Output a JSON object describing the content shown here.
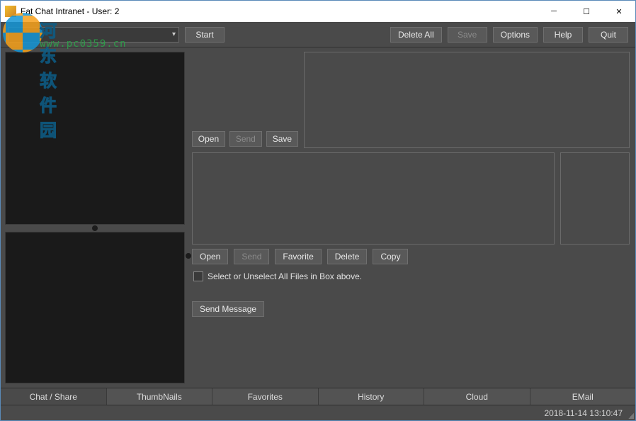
{
  "title": "Fat Chat Intranet - User: 2",
  "watermark": {
    "text1": "河东软件园",
    "text2": "www.pc0359.cn"
  },
  "toolbar": {
    "start": "Start",
    "deleteAll": "Delete All",
    "save": "Save",
    "options": "Options",
    "help": "Help",
    "quit": "Quit"
  },
  "section1": {
    "open": "Open",
    "send": "Send",
    "save": "Save"
  },
  "section2": {
    "open": "Open",
    "send": "Send",
    "favorite": "Favorite",
    "delete": "Delete",
    "copy": "Copy"
  },
  "checkboxLabel": "Select or Unselect All Files in Box above.",
  "sendMessage": "Send Message",
  "tabs": [
    "Chat / Share",
    "ThumbNails",
    "Favorites",
    "History",
    "Cloud",
    "EMail"
  ],
  "status": {
    "timestamp": "2018-11-14 13:10:47"
  },
  "winControls": {
    "min": "─",
    "max": "☐",
    "close": "✕"
  }
}
